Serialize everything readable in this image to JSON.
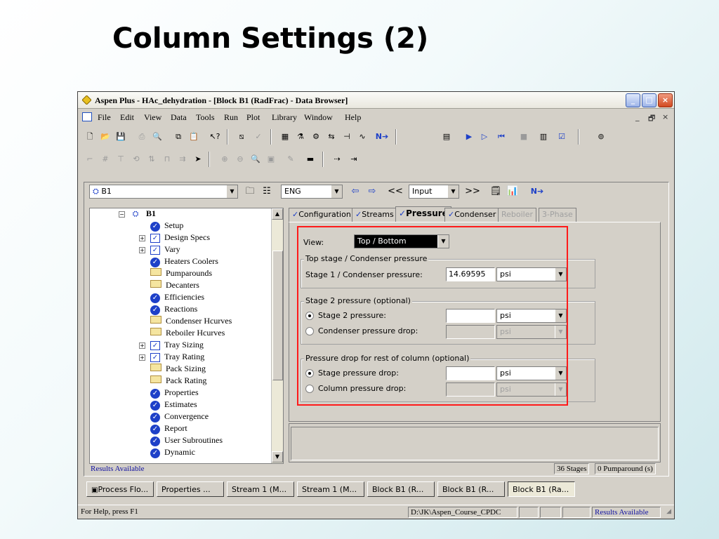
{
  "slide": {
    "title": "Column Settings  (2)"
  },
  "window": {
    "title": "Aspen Plus - HAc_dehydration - [Block B1 (RadFrac) - Data Browser]",
    "controls": [
      "_",
      "□",
      "×"
    ]
  },
  "menu": {
    "items": [
      "File",
      "Edit",
      "View",
      "Data",
      "Tools",
      "Run",
      "Plot",
      "Library",
      "Window",
      "Help"
    ],
    "mdi_controls": [
      "_",
      "🗗",
      "×"
    ]
  },
  "toolbar1": {
    "icons": [
      "new-icon",
      "open-icon",
      "save-icon",
      "print-icon",
      "print-preview-icon",
      "copy-icon",
      "paste-icon",
      "whats-this-icon",
      "flowsheet-icon",
      "check-icon",
      "data-browser-icon",
      "model-library-icon",
      "stream-icon",
      "block-icon",
      "units-icon",
      "next-icon",
      "control-panel-icon",
      "run-icon",
      "step-icon",
      "stop-icon",
      "reset-icon",
      "results-icon",
      "check-results-icon",
      "report-icon"
    ]
  },
  "nav": {
    "block_selector": "B1",
    "units": "ENG",
    "mode": "Input",
    "back": "⇦",
    "forward": "⇨",
    "prev": "<<",
    "next": ">>",
    "next_required": "N➔"
  },
  "tree": {
    "root": "B1",
    "items": [
      {
        "label": "Setup",
        "icon": "check"
      },
      {
        "label": "Design Specs",
        "icon": "checkbox"
      },
      {
        "label": "Vary",
        "icon": "checkbox"
      },
      {
        "label": "Heaters Coolers",
        "icon": "check"
      },
      {
        "label": "Pumparounds",
        "icon": "folder"
      },
      {
        "label": "Decanters",
        "icon": "folder"
      },
      {
        "label": "Efficiencies",
        "icon": "check"
      },
      {
        "label": "Reactions",
        "icon": "check"
      },
      {
        "label": "Condenser Hcurves",
        "icon": "folder"
      },
      {
        "label": "Reboiler Hcurves",
        "icon": "folder"
      },
      {
        "label": "Tray Sizing",
        "icon": "checkbox"
      },
      {
        "label": "Tray Rating",
        "icon": "checkbox"
      },
      {
        "label": "Pack Sizing",
        "icon": "folder"
      },
      {
        "label": "Pack Rating",
        "icon": "folder"
      },
      {
        "label": "Properties",
        "icon": "check"
      },
      {
        "label": "Estimates",
        "icon": "check"
      },
      {
        "label": "Convergence",
        "icon": "check"
      },
      {
        "label": "Report",
        "icon": "check"
      },
      {
        "label": "User Subroutines",
        "icon": "check"
      },
      {
        "label": "Dynamic",
        "icon": "check"
      }
    ]
  },
  "tabs": [
    {
      "label": "Configuration",
      "checked": true
    },
    {
      "label": "Streams",
      "checked": true
    },
    {
      "label": "Pressure",
      "checked": true
    },
    {
      "label": "Condenser",
      "checked": true
    },
    {
      "label": "Reboiler",
      "checked": false
    },
    {
      "label": "3-Phase",
      "checked": false
    }
  ],
  "form": {
    "view_label": "View:",
    "view_value": "Top / Bottom",
    "group_top": {
      "title": "Top stage / Condenser pressure",
      "field_label": "Stage 1 / Condenser pressure:",
      "value": "14.69595",
      "unit": "psi"
    },
    "group_stage2": {
      "title": "Stage 2 pressure (optional)",
      "opt1_label": "Stage 2 pressure:",
      "opt1_unit": "psi",
      "opt2_label": "Condenser pressure drop:",
      "opt2_unit": "psi"
    },
    "group_drop": {
      "title": "Pressure drop for rest of column (optional)",
      "opt1_label": "Stage pressure drop:",
      "opt1_unit": "psi",
      "opt2_label": "Column pressure drop:",
      "opt2_unit": "psi"
    }
  },
  "status_line": {
    "left": "Results Available",
    "stages": "36 Stages",
    "pumparounds": "0 Pumparound (s)"
  },
  "window_tabs": [
    "Process Flo...",
    "Properties ...",
    "Stream 1 (M...",
    "Stream 1 (M...",
    "Block B1 (R...",
    "Block B1 (R...",
    "Block B1 (Ra..."
  ],
  "statusbar": {
    "help": "For Help, press F1",
    "path": "D:\\JK\\Aspen_Course_CPDC",
    "results": "Results Available"
  },
  "colors": {
    "highlight": "#ff1a1a",
    "check": "#1e40c8",
    "titlebar": "#ece9d8"
  }
}
